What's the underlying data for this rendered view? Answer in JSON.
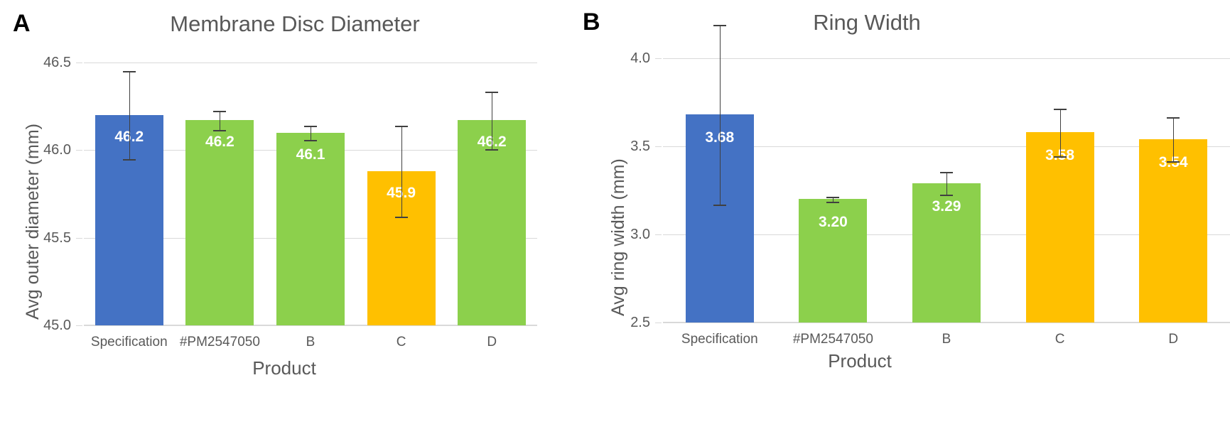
{
  "figure": {
    "panels": [
      {
        "letter": "A",
        "title": "Membrane Disc Diameter"
      },
      {
        "letter": "B",
        "title": "Ring Width"
      }
    ]
  },
  "chart_data": [
    {
      "type": "bar",
      "panel": "A",
      "title": "Membrane Disc Diameter",
      "xlabel": "Product",
      "ylabel": "Avg outer diameter (mm)",
      "categories": [
        "Specification",
        "#PM2547050",
        "B",
        "C",
        "D"
      ],
      "values": [
        46.2,
        46.17,
        46.1,
        45.88,
        46.17
      ],
      "value_labels": [
        "46.2",
        "46.2",
        "46.1",
        "45.9",
        "46.2"
      ],
      "errors": [
        0.25,
        0.055,
        0.04,
        0.26,
        0.165
      ],
      "colors": [
        "#4472C4",
        "#8CD04C",
        "#8CD04C",
        "#FFC000",
        "#8CD04C"
      ],
      "ylim": [
        45.0,
        46.5
      ],
      "yticks": [
        "46.5",
        "46.0",
        "45.5",
        "45.0"
      ],
      "ytick_values": [
        46.5,
        46.0,
        45.5,
        45.0
      ],
      "grid": true,
      "legend": "none"
    },
    {
      "type": "bar",
      "panel": "B",
      "title": "Ring Width",
      "xlabel": "Product",
      "ylabel": "Avg ring width (mm)",
      "categories": [
        "Specification",
        "#PM2547050",
        "B",
        "C",
        "D"
      ],
      "values": [
        3.68,
        3.2,
        3.29,
        3.58,
        3.54
      ],
      "value_labels": [
        "3.68",
        "3.20",
        "3.29",
        "3.58",
        "3.54"
      ],
      "errors": [
        0.51,
        0.015,
        0.065,
        0.135,
        0.125
      ],
      "colors": [
        "#4472C4",
        "#8CD04C",
        "#8CD04C",
        "#FFC000",
        "#FFC000"
      ],
      "ylim": [
        2.5,
        4.0
      ],
      "yticks": [
        "4.0",
        "3.5",
        "3.0",
        "2.5"
      ],
      "ytick_values": [
        4.0,
        3.5,
        3.0,
        2.5
      ],
      "grid": true,
      "legend": "none"
    }
  ]
}
